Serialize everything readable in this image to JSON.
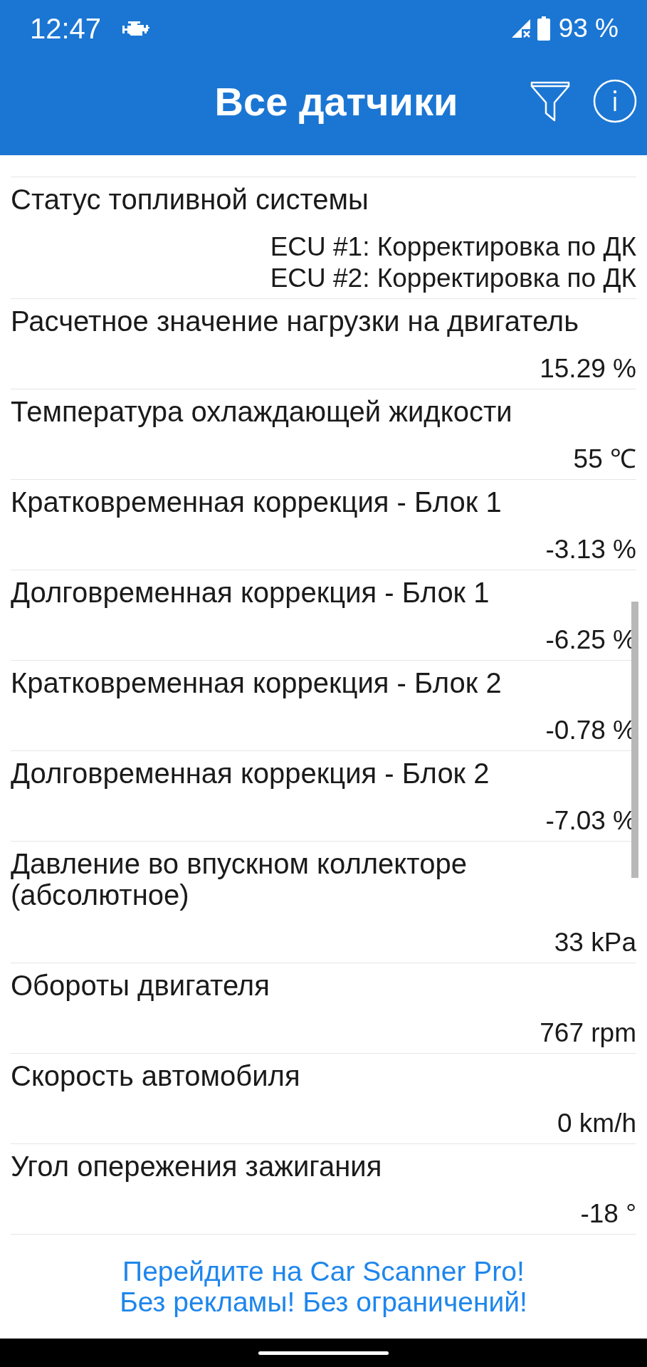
{
  "status_bar": {
    "time": "12:47",
    "battery": "93 %"
  },
  "toolbar": {
    "title": "Все датчики"
  },
  "sensors": [
    {
      "name": "Статус топливной системы",
      "values": [
        "ECU #1: Корректировка по ДК",
        "ECU #2: Корректировка по ДК"
      ]
    },
    {
      "name": "Расчетное значение нагрузки на двигатель",
      "values": [
        "15.29 %"
      ]
    },
    {
      "name": "Температура охлаждающей жидкости",
      "values": [
        "55 ℃"
      ]
    },
    {
      "name": "Кратковременная коррекция - Блок 1",
      "values": [
        "-3.13 %"
      ]
    },
    {
      "name": "Долговременная коррекция - Блок 1",
      "values": [
        "-6.25 %"
      ]
    },
    {
      "name": "Кратковременная коррекция - Блок 2",
      "values": [
        "-0.78 %"
      ]
    },
    {
      "name": "Долговременная коррекция - Блок 2",
      "values": [
        "-7.03 %"
      ]
    },
    {
      "name": "Давление во впускном коллекторе (абсолютное)",
      "values": [
        "33 kPa"
      ]
    },
    {
      "name": "Обороты двигателя",
      "values": [
        "767 rpm"
      ]
    },
    {
      "name": "Скорость автомобиля",
      "values": [
        "0 km/h"
      ]
    },
    {
      "name": "Угол опережения зажигания",
      "values": [
        "-18 °"
      ]
    }
  ],
  "promo": {
    "lines": [
      "Перейдите на Car Scanner Pro!",
      "Без рекламы! Без ограничений!"
    ]
  }
}
